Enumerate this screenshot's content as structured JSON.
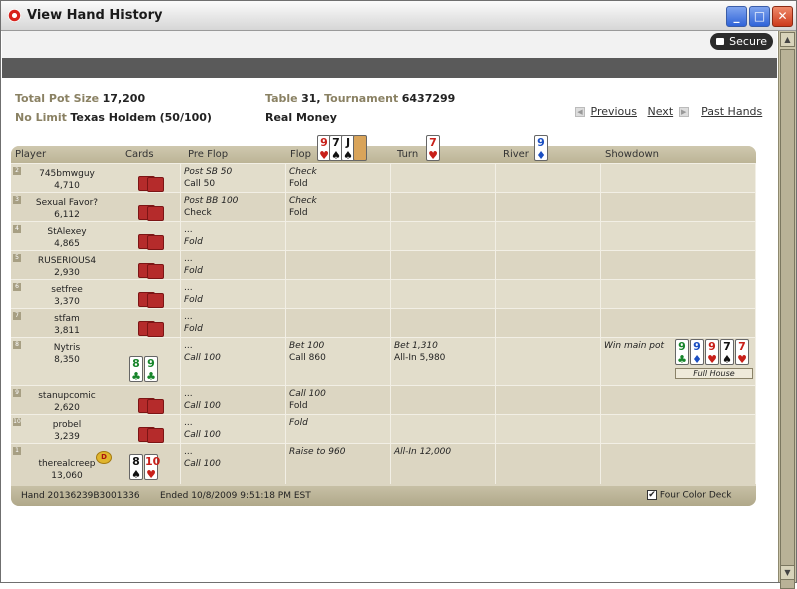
{
  "window": {
    "title": "View Hand History",
    "minimize": "_",
    "maximize": "□",
    "close": "✕"
  },
  "secure": {
    "label": "Secure"
  },
  "summary": {
    "total_pot_label": "Total Pot Size",
    "total_pot_value": "17,200",
    "game_limit_label": "No Limit",
    "game_name": "Texas Holdem",
    "game_blinds": "(50/100)",
    "table_label": "Table",
    "table_value": "31,",
    "tournament_label": "Tournament",
    "tournament_value": "6437299",
    "money": "Real Money"
  },
  "nav": {
    "previous": "Previous",
    "next": "Next",
    "past_hands": "Past Hands"
  },
  "columns": [
    "Player",
    "Cards",
    "Pre Flop",
    "Flop",
    "Turn",
    "River",
    "Showdown"
  ],
  "board": {
    "flop": [
      {
        "rank": "9",
        "suit": "♥",
        "color": "r"
      },
      {
        "rank": "7",
        "suit": "♠",
        "color": "b"
      },
      {
        "rank": "J",
        "suit": "♠",
        "color": "b"
      }
    ],
    "turn": [
      {
        "rank": "7",
        "suit": "♥",
        "color": "r"
      }
    ],
    "river": [
      {
        "rank": "9",
        "suit": "♦",
        "color": "u"
      }
    ]
  },
  "players": [
    {
      "seat": "2",
      "name": "745bmwguy",
      "chips": "4,710",
      "preflop": [
        "Post SB 50",
        "Call 50"
      ],
      "preflop_it": [
        true,
        false
      ],
      "flop": [
        "Check",
        "Fold"
      ],
      "flop_it": [
        true,
        false
      ],
      "turn": [],
      "river": [],
      "showdown": ""
    },
    {
      "seat": "3",
      "name": "Sexual Favor?",
      "chips": "6,112",
      "preflop": [
        "Post BB 100",
        "Check"
      ],
      "preflop_it": [
        true,
        false
      ],
      "flop": [
        "Check",
        "Fold"
      ],
      "flop_it": [
        true,
        false
      ],
      "turn": [],
      "river": [],
      "showdown": ""
    },
    {
      "seat": "4",
      "name": "StAlexey",
      "chips": "4,865",
      "preflop": [
        "...",
        "Fold"
      ],
      "preflop_it": [
        false,
        true
      ],
      "flop": [],
      "turn": [],
      "river": [],
      "showdown": ""
    },
    {
      "seat": "5",
      "name": "RUSERIOUS4",
      "chips": "2,930",
      "preflop": [
        "...",
        "Fold"
      ],
      "preflop_it": [
        false,
        true
      ],
      "flop": [],
      "turn": [],
      "river": [],
      "showdown": ""
    },
    {
      "seat": "6",
      "name": "setfree",
      "chips": "3,370",
      "preflop": [
        "...",
        "Fold"
      ],
      "preflop_it": [
        false,
        true
      ],
      "flop": [],
      "turn": [],
      "river": [],
      "showdown": ""
    },
    {
      "seat": "7",
      "name": "stfam",
      "chips": "3,811",
      "preflop": [
        "...",
        "Fold"
      ],
      "preflop_it": [
        false,
        true
      ],
      "flop": [],
      "turn": [],
      "river": [],
      "showdown": ""
    },
    {
      "seat": "8",
      "name": "Nytris",
      "chips": "8,350",
      "preflop": [
        "...",
        "Call 100"
      ],
      "preflop_it": [
        false,
        true
      ],
      "flop": [
        "Bet 100",
        "Call 860"
      ],
      "flop_it": [
        true,
        false
      ],
      "turn": [
        "Bet 1,310",
        "All-In 5,980"
      ],
      "turn_it": [
        true,
        false
      ],
      "showdown": "Win main pot",
      "hand": "Full House"
    },
    {
      "seat": "9",
      "name": "stanupcomic",
      "chips": "2,620",
      "preflop": [
        "...",
        "Call 100"
      ],
      "preflop_it": [
        false,
        true
      ],
      "flop": [
        "Call 100",
        "Fold"
      ],
      "flop_it": [
        true,
        false
      ],
      "turn": [],
      "river": [],
      "showdown": ""
    },
    {
      "seat": "10",
      "name": "probel",
      "chips": "3,239",
      "preflop": [
        "...",
        "Call 100"
      ],
      "preflop_it": [
        false,
        true
      ],
      "flop": [
        "Fold"
      ],
      "flop_it": [
        true
      ],
      "turn": [],
      "river": [],
      "showdown": ""
    },
    {
      "seat": "1",
      "name": "therealcreep",
      "chips": "13,060",
      "preflop": [
        "...",
        "Call 100"
      ],
      "preflop_it": [
        false,
        true
      ],
      "flop": [
        "Raise to 960"
      ],
      "flop_it": [
        true
      ],
      "turn": [
        "All-In 12,000"
      ],
      "turn_it": [
        true
      ],
      "showdown": "",
      "dealer": "D"
    }
  ],
  "shown_cards": {
    "nytris_hole": [
      {
        "rank": "8",
        "suit": "♣",
        "color": "g"
      },
      {
        "rank": "9",
        "suit": "♣",
        "color": "g"
      }
    ],
    "therealcreep_hole": [
      {
        "rank": "8",
        "suit": "♠",
        "color": "b"
      },
      {
        "rank": "10",
        "suit": "♥",
        "color": "r"
      }
    ],
    "showdown_hand": [
      {
        "rank": "9",
        "suit": "♣",
        "color": "g"
      },
      {
        "rank": "9",
        "suit": "♦",
        "color": "u"
      },
      {
        "rank": "9",
        "suit": "♥",
        "color": "r"
      },
      {
        "rank": "7",
        "suit": "♠",
        "color": "b"
      },
      {
        "rank": "7",
        "suit": "♥",
        "color": "r"
      }
    ]
  },
  "footer": {
    "hand_label": "Hand 20136239B3001336",
    "ended": "Ended 10/8/2009 9:51:18 PM EST",
    "four_color_label": "Four Color Deck",
    "four_color_checked": "✔"
  }
}
